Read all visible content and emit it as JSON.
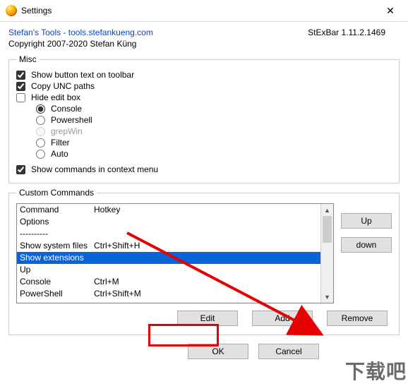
{
  "window": {
    "title": "Settings",
    "close_glyph": "✕"
  },
  "header": {
    "link_text": "Stefan's Tools - tools.stefankueng.com",
    "version": "StExBar 1.11.2.1469",
    "copyright": "Copyright 2007-2020 Stefan Küng"
  },
  "misc": {
    "legend": "Misc",
    "show_button_text": {
      "label": "Show button text on toolbar",
      "checked": true
    },
    "copy_unc": {
      "label": "Copy UNC paths",
      "checked": true
    },
    "hide_edit": {
      "label": "Hide edit box",
      "checked": false
    },
    "radios": {
      "selected": "console",
      "console": "Console",
      "powershell": "Powershell",
      "grepwin": "grepWin",
      "filter": "Filter",
      "auto": "Auto"
    },
    "context_menu": {
      "label": "Show commands in context menu",
      "checked": true
    }
  },
  "commands": {
    "legend": "Custom Commands",
    "headers": {
      "col1": "Command",
      "col2": "Hotkey"
    },
    "rows": [
      {
        "c1": "Options",
        "c2": ""
      },
      {
        "c1": "----------",
        "c2": ""
      },
      {
        "c1": "Show system files",
        "c2": "Ctrl+Shift+H"
      },
      {
        "c1": "Show extensions",
        "c2": "",
        "selected": true
      },
      {
        "c1": "Up",
        "c2": ""
      },
      {
        "c1": "Console",
        "c2": "Ctrl+M"
      },
      {
        "c1": "PowerShell",
        "c2": "Ctrl+Shift+M"
      }
    ],
    "btn_up": "Up",
    "btn_down": "down",
    "btn_edit": "Edit",
    "btn_add": "Add",
    "btn_remove": "Remove"
  },
  "dialog": {
    "ok": "OK",
    "cancel": "Cancel"
  },
  "watermark": "下载吧"
}
